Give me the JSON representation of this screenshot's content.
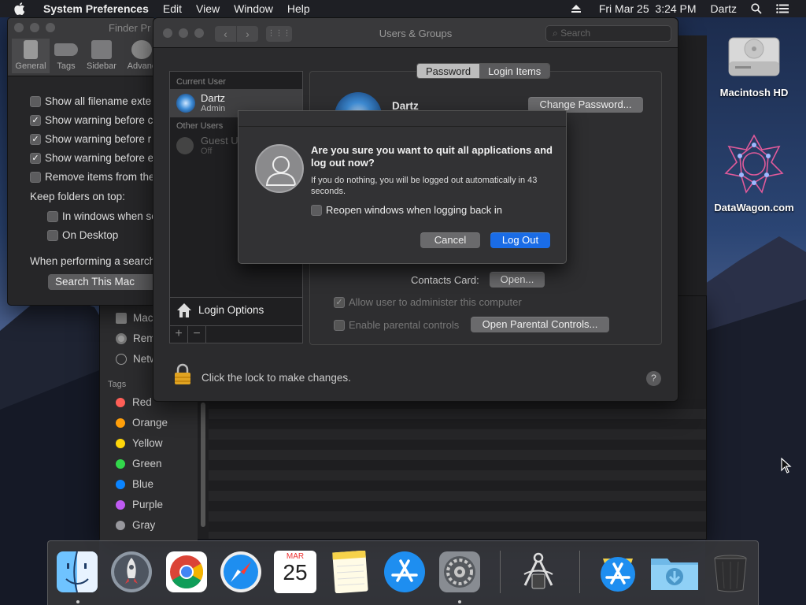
{
  "menubar": {
    "app": "System Preferences",
    "menus": [
      "Edit",
      "View",
      "Window",
      "Help"
    ],
    "datetime": "Fri Mar 25  3:24 PM",
    "user": "Dartz"
  },
  "desktop": {
    "icons": [
      {
        "label": "Macintosh HD",
        "icon": "hard-drive-icon"
      },
      {
        "label": "DataWagon.com",
        "icon": "datawagon-logo-icon"
      }
    ]
  },
  "finder_prefs": {
    "title": "Finder Pr",
    "toolbar": [
      "General",
      "Tags",
      "Sidebar",
      "Advanc"
    ],
    "options": [
      {
        "label": "Show all filename exte",
        "checked": false
      },
      {
        "label": "Show warning before c",
        "checked": true
      },
      {
        "label": "Show warning before r",
        "checked": true
      },
      {
        "label": "Show warning before e",
        "checked": true
      },
      {
        "label": "Remove items from the",
        "checked": false
      }
    ],
    "keep_folders_label": "Keep folders on top:",
    "keep_options": [
      {
        "label": "In windows when so",
        "checked": false
      },
      {
        "label": "On Desktop",
        "checked": false
      }
    ],
    "search_label": "When performing a search",
    "search_value": "Search This Mac"
  },
  "finder_window": {
    "locations": [
      {
        "label": "Mac",
        "icon": "disk-icon"
      },
      {
        "label": "Rem",
        "icon": "remote-disc-icon"
      },
      {
        "label": "Netw",
        "icon": "network-icon"
      }
    ],
    "tags_header": "Tags",
    "tags": [
      {
        "label": "Red",
        "color": "#ff5f57"
      },
      {
        "label": "Orange",
        "color": "#ff9f0a"
      },
      {
        "label": "Yellow",
        "color": "#ffd60a"
      },
      {
        "label": "Green",
        "color": "#32d74b"
      },
      {
        "label": "Blue",
        "color": "#0a84ff"
      },
      {
        "label": "Purple",
        "color": "#bf5af2"
      },
      {
        "label": "Gray",
        "color": "#98989d"
      }
    ]
  },
  "users_groups": {
    "title": "Users & Groups",
    "search_placeholder": "Search",
    "current_user_header": "Current User",
    "current_user": {
      "name": "Dartz",
      "role": "Admin"
    },
    "other_users_header": "Other Users",
    "guest_user": {
      "name": "Guest U",
      "status": "Off"
    },
    "login_options": "Login Options",
    "tabs": [
      "Password",
      "Login Items"
    ],
    "active_tab": "Password",
    "profile_name": "Dartz",
    "change_password": "Change Password...",
    "contacts_card_label": "Contacts Card:",
    "open_button": "Open...",
    "allow_admin": {
      "label": "Allow user to administer this computer",
      "checked": true
    },
    "parental": {
      "label": "Enable parental controls",
      "checked": false
    },
    "open_parental": "Open Parental Controls...",
    "lock_text": "Click the lock to make changes.",
    "help": "?"
  },
  "dialog": {
    "heading": "Are you sure you want to quit all applications and log out now?",
    "message": "If you do nothing, you will be logged out automatically in 43 seconds.",
    "reopen": {
      "label": "Reopen windows when logging back in",
      "checked": false
    },
    "cancel": "Cancel",
    "logout": "Log Out"
  },
  "dock": {
    "apps": [
      {
        "name": "Finder",
        "icon": "finder-icon",
        "running": true
      },
      {
        "name": "Launchpad",
        "icon": "launchpad-icon",
        "running": false
      },
      {
        "name": "Chrome",
        "icon": "chrome-icon",
        "running": false
      },
      {
        "name": "Safari",
        "icon": "safari-icon",
        "running": false
      },
      {
        "name": "Calendar",
        "icon": "calendar-icon",
        "running": false,
        "month": "MAR",
        "day": "25"
      },
      {
        "name": "Notes",
        "icon": "notes-icon",
        "running": false
      },
      {
        "name": "App Store",
        "icon": "app-store-icon",
        "running": false
      },
      {
        "name": "System Preferences",
        "icon": "system-preferences-icon",
        "running": true
      },
      {
        "name": "Instruments",
        "icon": "instruments-icon",
        "running": false
      },
      {
        "name": "App Store Downloads",
        "icon": "app-store-icon",
        "running": false
      },
      {
        "name": "Downloads",
        "icon": "downloads-folder-icon",
        "running": false
      },
      {
        "name": "Trash",
        "icon": "trash-icon",
        "running": false
      }
    ]
  }
}
